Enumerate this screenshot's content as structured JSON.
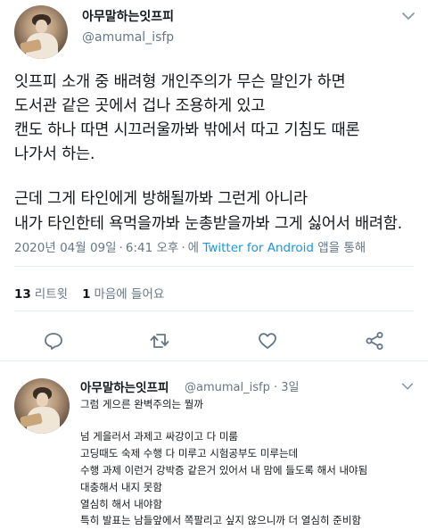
{
  "tweet": {
    "display_name": "아무말하는잇프피",
    "handle": "@amumal_isfp",
    "text_lines": [
      "잇프피 소개 중 배려형 개인주의가 무슨 말인가 하면",
      "도서관 같은 곳에서 겁나 조용하게 있고",
      "캔도 하나 따면 시끄러울까봐 밖에서 따고 기침도 때론",
      "나가서 하는.",
      "근데 그게 타인에게 방해될까봐 그런게 아니라",
      "내가 타인한테 욕먹을까봐 눈총받을까봐 그게 싫어서 배려함."
    ],
    "date": "2020년 04월 09일",
    "time": "6:41 오후",
    "via_prefix": "에",
    "app": "Twitter for Android",
    "via_suffix": "앱을 통해",
    "retweets_count": "13",
    "retweets_label": "리트윗",
    "likes_count": "1",
    "likes_label": "마음에 들어요"
  },
  "actions": {
    "reply_icon": "reply-icon",
    "retweet_icon": "retweet-icon",
    "like_icon": "heart-icon",
    "share_icon": "share-icon"
  },
  "reply": {
    "display_name": "아무말하는잇프피",
    "handle": "@amumal_isfp · 3일",
    "lines": [
      "그럼 게으른 완벽주의는 뭘까",
      "넘 게을러서 과제고 싸강이고 다 미룸",
      "고딩때도 숙제 수행 다 미루고 시험공부도 미루는데",
      "수행 과제 이런거 강박증 같은거 있어서 내 맘에 들도록 해서 내야됨",
      "대충해서 내지 못함",
      "열심히 해서 내야함",
      "특히 발표는 남들앞에서 쪽팔리고 싶지 않으니까 더 열심히 준비함"
    ]
  },
  "colors": {
    "text": "#14171a",
    "secondary": "#657786",
    "link": "#1b95e0",
    "divider": "#e6ecf0"
  }
}
